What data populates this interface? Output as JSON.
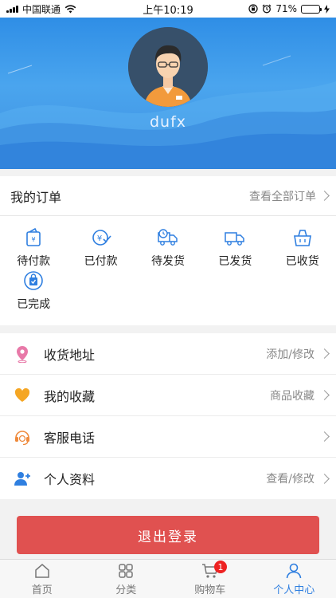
{
  "status_bar": {
    "carrier": "中国联通",
    "time": "上午10:19",
    "battery_percent": "71%",
    "battery_level": 0.71
  },
  "profile": {
    "username": "dufx"
  },
  "orders": {
    "title": "我的订单",
    "view_all": "查看全部订单",
    "items": [
      {
        "label": "待付款",
        "icon": "wallet-icon"
      },
      {
        "label": "已付款",
        "icon": "yen-check-icon"
      },
      {
        "label": "待发货",
        "icon": "truck-clock-icon"
      },
      {
        "label": "已发货",
        "icon": "truck-icon"
      },
      {
        "label": "已收货",
        "icon": "basket-icon"
      },
      {
        "label": "已完成",
        "icon": "bag-check-icon"
      }
    ]
  },
  "menu": [
    {
      "label": "收货地址",
      "extra": "添加/修改",
      "icon": "location-pin-icon"
    },
    {
      "label": "我的收藏",
      "extra": "商品收藏",
      "icon": "heart-icon"
    },
    {
      "label": "客服电话",
      "extra": "",
      "icon": "headset-icon"
    },
    {
      "label": "个人资料",
      "extra": "查看/修改",
      "icon": "user-add-icon"
    }
  ],
  "logout_label": "退出登录",
  "tabbar": {
    "items": [
      {
        "label": "首页",
        "icon": "home-icon"
      },
      {
        "label": "分类",
        "icon": "grid-icon"
      },
      {
        "label": "购物车",
        "icon": "cart-icon",
        "badge": "1"
      },
      {
        "label": "个人中心",
        "icon": "person-icon"
      }
    ],
    "active_index": 3
  },
  "colors": {
    "accent": "#2f7fe0",
    "logout": "#e05150",
    "badge": "#e22222"
  }
}
